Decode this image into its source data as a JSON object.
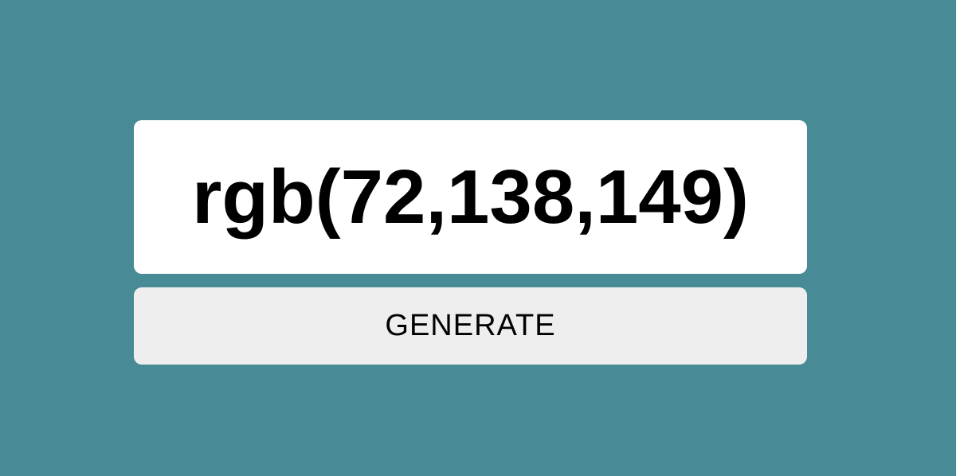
{
  "background_color": "#488a95",
  "display": {
    "value": "rgb(72,138,149)",
    "background_color": "#ffffff"
  },
  "generate_button": {
    "label": "GENERATE",
    "background_color": "#eeeeee"
  }
}
